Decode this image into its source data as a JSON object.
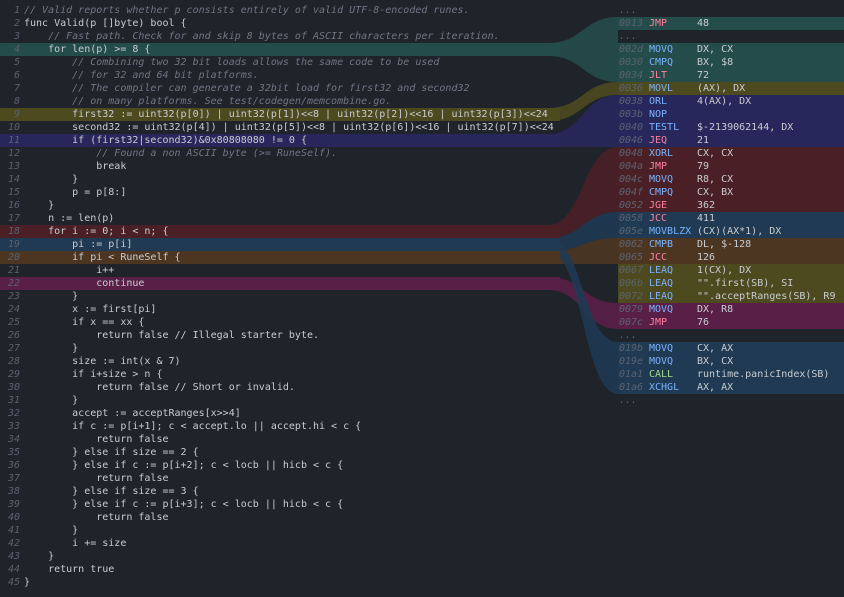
{
  "source_lines": [
    {
      "n": "1",
      "code": "// Valid reports whether p consists entirely of valid UTF-8-encoded runes.",
      "cls": "",
      "comment": true
    },
    {
      "n": "2",
      "code": "func Valid(p []byte) bool {",
      "cls": ""
    },
    {
      "n": "3",
      "code": "    // Fast path. Check for and skip 8 bytes of ASCII characters per iteration.",
      "cls": "",
      "comment": true
    },
    {
      "n": "4",
      "code": "    for len(p) >= 8 {",
      "cls": "hl-teal"
    },
    {
      "n": "5",
      "code": "        // Combining two 32 bit loads allows the same code to be used",
      "cls": "",
      "comment": true
    },
    {
      "n": "6",
      "code": "        // for 32 and 64 bit platforms.",
      "cls": "",
      "comment": true
    },
    {
      "n": "7",
      "code": "        // The compiler can generate a 32bit load for first32 and second32",
      "cls": "",
      "comment": true
    },
    {
      "n": "8",
      "code": "        // on many platforms. See test/codegen/memcombine.go.",
      "cls": "",
      "comment": true
    },
    {
      "n": "9",
      "code": "        first32 := uint32(p[0]) | uint32(p[1])<<8 | uint32(p[2])<<16 | uint32(p[3])<<24",
      "cls": "hl-olive"
    },
    {
      "n": "10",
      "code": "        second32 := uint32(p[4]) | uint32(p[5])<<8 | uint32(p[6])<<16 | uint32(p[7])<<24",
      "cls": ""
    },
    {
      "n": "11",
      "code": "        if (first32|second32)&0x80808080 != 0 {",
      "cls": "hl-blue"
    },
    {
      "n": "12",
      "code": "            // Found a non ASCII byte (>= RuneSelf).",
      "cls": "",
      "comment": true
    },
    {
      "n": "13",
      "code": "            break",
      "cls": ""
    },
    {
      "n": "14",
      "code": "        }",
      "cls": ""
    },
    {
      "n": "15",
      "code": "        p = p[8:]",
      "cls": ""
    },
    {
      "n": "16",
      "code": "    }",
      "cls": ""
    },
    {
      "n": "17",
      "code": "    n := len(p)",
      "cls": ""
    },
    {
      "n": "18",
      "code": "    for i := 0; i < n; {",
      "cls": "hl-red"
    },
    {
      "n": "19",
      "code": "        pi := p[i]",
      "cls": "hl-navy"
    },
    {
      "n": "20",
      "code": "        if pi < RuneSelf {",
      "cls": "hl-brown"
    },
    {
      "n": "21",
      "code": "            i++",
      "cls": ""
    },
    {
      "n": "22",
      "code": "            continue",
      "cls": "hl-mag"
    },
    {
      "n": "23",
      "code": "        }",
      "cls": ""
    },
    {
      "n": "24",
      "code": "        x := first[pi]",
      "cls": ""
    },
    {
      "n": "25",
      "code": "        if x == xx {",
      "cls": ""
    },
    {
      "n": "26",
      "code": "            return false // Illegal starter byte.",
      "cls": ""
    },
    {
      "n": "27",
      "code": "        }",
      "cls": ""
    },
    {
      "n": "28",
      "code": "        size := int(x & 7)",
      "cls": ""
    },
    {
      "n": "29",
      "code": "        if i+size > n {",
      "cls": ""
    },
    {
      "n": "30",
      "code": "            return false // Short or invalid.",
      "cls": ""
    },
    {
      "n": "31",
      "code": "        }",
      "cls": ""
    },
    {
      "n": "32",
      "code": "        accept := acceptRanges[x>>4]",
      "cls": ""
    },
    {
      "n": "33",
      "code": "        if c := p[i+1]; c < accept.lo || accept.hi < c {",
      "cls": ""
    },
    {
      "n": "34",
      "code": "            return false",
      "cls": ""
    },
    {
      "n": "35",
      "code": "        } else if size == 2 {",
      "cls": ""
    },
    {
      "n": "36",
      "code": "        } else if c := p[i+2]; c < locb || hicb < c {",
      "cls": ""
    },
    {
      "n": "37",
      "code": "            return false",
      "cls": ""
    },
    {
      "n": "38",
      "code": "        } else if size == 3 {",
      "cls": ""
    },
    {
      "n": "39",
      "code": "        } else if c := p[i+3]; c < locb || hicb < c {",
      "cls": ""
    },
    {
      "n": "40",
      "code": "            return false",
      "cls": ""
    },
    {
      "n": "41",
      "code": "        }",
      "cls": ""
    },
    {
      "n": "42",
      "code": "        i += size",
      "cls": ""
    },
    {
      "n": "43",
      "code": "    }",
      "cls": ""
    },
    {
      "n": "44",
      "code": "    return true",
      "cls": ""
    },
    {
      "n": "45",
      "code": "}",
      "cls": ""
    }
  ],
  "asm_lines": [
    {
      "addr": "...",
      "op": "",
      "args": "",
      "cls": ""
    },
    {
      "addr": "0013",
      "op": "JMP",
      "args": "48",
      "cls": "hl-teal"
    },
    {
      "addr": "...",
      "op": "",
      "args": "",
      "cls": ""
    },
    {
      "addr": "002d",
      "op": "MOVQ",
      "args": "DX, CX",
      "cls": "hl-teal"
    },
    {
      "addr": "0030",
      "op": "CMPQ",
      "args": "BX, $8",
      "cls": "hl-teal"
    },
    {
      "addr": "0034",
      "op": "JLT",
      "args": "72",
      "cls": "hl-teal"
    },
    {
      "addr": "0036",
      "op": "MOVL",
      "args": "(AX), DX",
      "cls": "hl-olive"
    },
    {
      "addr": "0038",
      "op": "ORL",
      "args": "4(AX), DX",
      "cls": "hl-blue"
    },
    {
      "addr": "003b",
      "op": "NOP",
      "args": "",
      "cls": "hl-blue"
    },
    {
      "addr": "0040",
      "op": "TESTL",
      "args": "$-2139062144, DX",
      "cls": "hl-blue"
    },
    {
      "addr": "0046",
      "op": "JEQ",
      "args": "21",
      "cls": "hl-blue"
    },
    {
      "addr": "0048",
      "op": "XORL",
      "args": "CX, CX",
      "cls": "hl-red"
    },
    {
      "addr": "004a",
      "op": "JMP",
      "args": "79",
      "cls": "hl-red"
    },
    {
      "addr": "004c",
      "op": "MOVQ",
      "args": "R8, CX",
      "cls": "hl-red"
    },
    {
      "addr": "004f",
      "op": "CMPQ",
      "args": "CX, BX",
      "cls": "hl-red"
    },
    {
      "addr": "0052",
      "op": "JGE",
      "args": "362",
      "cls": "hl-red"
    },
    {
      "addr": "0058",
      "op": "JCC",
      "args": "411",
      "cls": "hl-navy"
    },
    {
      "addr": "005e",
      "op": "MOVBLZX",
      "args": "(CX)(AX*1), DX",
      "cls": "hl-navy"
    },
    {
      "addr": "0062",
      "op": "CMPB",
      "args": "DL, $-128",
      "cls": "hl-brown"
    },
    {
      "addr": "0065",
      "op": "JCC",
      "args": "126",
      "cls": "hl-brown"
    },
    {
      "addr": "0067",
      "op": "LEAQ",
      "args": "1(CX), DX",
      "cls": "hl-olive"
    },
    {
      "addr": "006b",
      "op": "LEAQ",
      "args": "\"\".first(SB), SI",
      "cls": "hl-olive"
    },
    {
      "addr": "0072",
      "op": "LEAQ",
      "args": "\"\".acceptRanges(SB), R9",
      "cls": "hl-olive"
    },
    {
      "addr": "0079",
      "op": "MOVQ",
      "args": "DX, R8",
      "cls": "hl-mag"
    },
    {
      "addr": "007c",
      "op": "JMP",
      "args": "76",
      "cls": "hl-mag"
    },
    {
      "addr": "...",
      "op": "",
      "args": "",
      "cls": ""
    },
    {
      "addr": "019b",
      "op": "MOVQ",
      "args": "CX, AX",
      "cls": "hl-navy"
    },
    {
      "addr": "019e",
      "op": "MOVQ",
      "args": "BX, CX",
      "cls": "hl-navy"
    },
    {
      "addr": "01a1",
      "op": "CALL",
      "args": "runtime.panicIndex(SB)",
      "cls": "hl-navy"
    },
    {
      "addr": "01a6",
      "op": "XCHGL",
      "args": "AX, AX",
      "cls": "hl-navy"
    },
    {
      "addr": "...",
      "op": "",
      "args": "",
      "cls": ""
    }
  ],
  "colors": {
    "background": "#1f232a",
    "teal": "#234c4a",
    "olive": "#4d4a1f",
    "red": "#4a2026",
    "blue": "#27275c",
    "navy": "#1f3a52",
    "magenta": "#5a1f47",
    "brown": "#4c3622"
  }
}
